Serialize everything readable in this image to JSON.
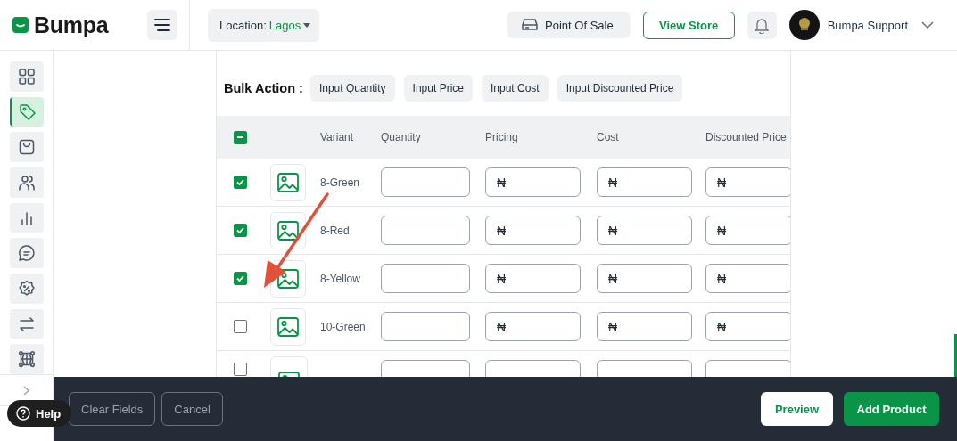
{
  "header": {
    "brand": "Bumpa",
    "location_label": "Location:",
    "location_value": "Lagos",
    "pos_button": "Point Of Sale",
    "view_store_button": "View Store",
    "user_name": "Bumpa Support"
  },
  "sidebar": {
    "items": [
      {
        "kind": "grid",
        "selected": false
      },
      {
        "kind": "tag",
        "selected": true
      },
      {
        "kind": "bag",
        "selected": false
      },
      {
        "kind": "users",
        "selected": false
      },
      {
        "kind": "chart",
        "selected": false
      },
      {
        "kind": "chat",
        "selected": false
      },
      {
        "kind": "discount",
        "selected": false
      },
      {
        "kind": "transfer",
        "selected": false
      },
      {
        "kind": "network",
        "selected": false
      }
    ],
    "help_button": "Help"
  },
  "bulk_action": {
    "label": "Bulk Action :",
    "buttons": [
      "Input Quantity",
      "Input Price",
      "Input Cost",
      "Input Discounted Price"
    ]
  },
  "table": {
    "select_all": {
      "indeterminate": true
    },
    "columns": [
      "Variant",
      "Quantity",
      "Pricing",
      "Cost",
      "Discounted Price"
    ],
    "rows": [
      {
        "kind": "full",
        "checked": true,
        "variant": "8-Green",
        "pricing": "₦",
        "cost": "₦",
        "discounted_price": "₦"
      },
      {
        "kind": "full",
        "checked": true,
        "variant": "8-Red",
        "pricing": "₦",
        "cost": "₦",
        "discounted_price": "₦"
      },
      {
        "kind": "full",
        "checked": true,
        "variant": "8-Yellow",
        "pricing": "₦",
        "cost": "₦",
        "discounted_price": "₦"
      },
      {
        "kind": "full",
        "checked": false,
        "variant": "10-Green",
        "pricing": "₦",
        "cost": "₦",
        "discounted_price": "₦"
      },
      {
        "kind": "cut",
        "checked": false
      }
    ]
  },
  "footer": {
    "buttons": [
      {
        "label": "Clear Fields",
        "kind": "outline"
      },
      {
        "label": "Cancel",
        "kind": "outline"
      },
      {
        "label": "Preview",
        "kind": "light"
      },
      {
        "label": "Add Product",
        "kind": "primary"
      }
    ]
  }
}
